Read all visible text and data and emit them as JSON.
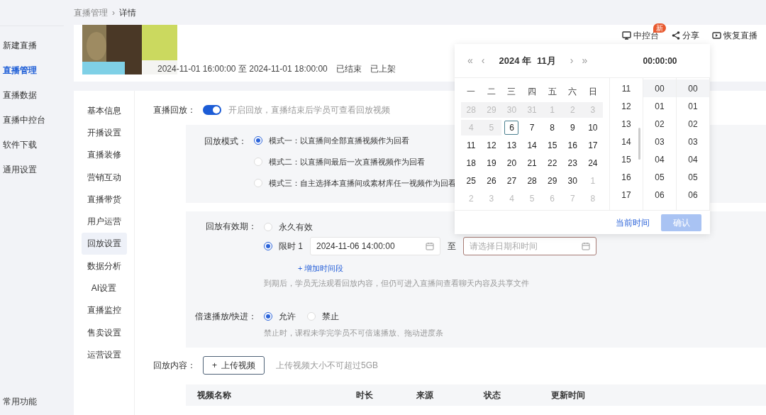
{
  "sidebar": {
    "items": [
      {
        "label": "新建直播",
        "selected": false
      },
      {
        "label": "直播管理",
        "selected": true
      },
      {
        "label": "直播数据",
        "selected": false
      },
      {
        "label": "直播中控台",
        "selected": false
      },
      {
        "label": "软件下载",
        "selected": false
      },
      {
        "label": "通用设置",
        "selected": false
      }
    ],
    "footer": "常用功能"
  },
  "breadcrumb": [
    "直播管理",
    "详情"
  ],
  "breadcrumb_separator": "›",
  "header": {
    "time": "2024-11-01 16:00:00 至 2024-11-01 18:00:00",
    "status": "已结束",
    "shelf": "已上架",
    "actions": [
      {
        "label": "中控台",
        "badge": "新"
      },
      {
        "label": "分享"
      },
      {
        "label": "恢复直播"
      }
    ]
  },
  "settings_nav": [
    {
      "label": "基本信息",
      "selected": false
    },
    {
      "label": "开播设置",
      "selected": false
    },
    {
      "label": "直播装修",
      "selected": false
    },
    {
      "label": "营销互动",
      "selected": false
    },
    {
      "label": "直播带货",
      "selected": false
    },
    {
      "label": "用户运营",
      "selected": false
    },
    {
      "label": "回放设置",
      "selected": true
    },
    {
      "label": "数据分析",
      "selected": false
    },
    {
      "label": "AI设置",
      "selected": false
    },
    {
      "label": "直播监控",
      "selected": false
    },
    {
      "label": "售卖设置",
      "selected": false
    },
    {
      "label": "运营设置",
      "selected": false
    }
  ],
  "replay": {
    "label": "直播回放：",
    "on": true,
    "hint": "开启回放，直播结束后学员可查看回放视频"
  },
  "mode": {
    "label": "回放模式：",
    "options": [
      {
        "label": "模式一：以直播间全部直播视频作为回看",
        "selected": true
      },
      {
        "label": "模式二：以直播间最后一次直播视频作为回看",
        "selected": false
      },
      {
        "label": "模式三：自主选择本直播间或素材库任一视频作为回看",
        "selected": false
      }
    ]
  },
  "validity": {
    "label": "回放有效期：",
    "options": [
      {
        "label": "永久有效",
        "selected": false
      },
      {
        "label": "限时 1",
        "selected": true
      }
    ],
    "start": "2024-11-06 14:00:00",
    "to": "至",
    "end_placeholder": "请选择日期和时间",
    "add": "+ 增加时间段",
    "hint": "到期后，学员无法观看回放内容，但仍可进入直播间查看聊天内容及共享文件"
  },
  "speed": {
    "label": "倍速播放/快进：",
    "options": [
      {
        "label": "允许",
        "selected": true
      },
      {
        "label": "禁止",
        "selected": false
      }
    ],
    "hint": "禁止时，课程未学完学员不可倍速播放、拖动进度条"
  },
  "content": {
    "label": "回放内容：",
    "upload": "上传视频",
    "upload_icon": "+",
    "hint": "上传视频大小不可超过5GB",
    "columns": [
      "视频名称",
      "时长",
      "来源",
      "状态",
      "更新时间"
    ]
  },
  "picker": {
    "nav": [
      "«",
      "‹",
      "›",
      "»"
    ],
    "year": "2024 年",
    "month": "11月",
    "time": "00:00:00",
    "weekdays": [
      "一",
      "二",
      "三",
      "四",
      "五",
      "六",
      "日"
    ],
    "days": [
      {
        "d": "28",
        "kind": "disabled"
      },
      {
        "d": "29",
        "kind": "disabled"
      },
      {
        "d": "30",
        "kind": "disabled"
      },
      {
        "d": "31",
        "kind": "disabled"
      },
      {
        "d": "1",
        "kind": "disabled"
      },
      {
        "d": "2",
        "kind": "disabled"
      },
      {
        "d": "3",
        "kind": "disabled"
      },
      {
        "d": "4",
        "kind": "disabled"
      },
      {
        "d": "5",
        "kind": "disabled"
      },
      {
        "d": "6",
        "kind": "today"
      },
      {
        "d": "7",
        "kind": "normal"
      },
      {
        "d": "8",
        "kind": "normal"
      },
      {
        "d": "9",
        "kind": "normal"
      },
      {
        "d": "10",
        "kind": "normal"
      },
      {
        "d": "11",
        "kind": "normal"
      },
      {
        "d": "12",
        "kind": "normal"
      },
      {
        "d": "13",
        "kind": "normal"
      },
      {
        "d": "14",
        "kind": "normal"
      },
      {
        "d": "15",
        "kind": "normal"
      },
      {
        "d": "16",
        "kind": "normal"
      },
      {
        "d": "17",
        "kind": "normal"
      },
      {
        "d": "18",
        "kind": "normal"
      },
      {
        "d": "19",
        "kind": "normal"
      },
      {
        "d": "20",
        "kind": "normal"
      },
      {
        "d": "21",
        "kind": "normal"
      },
      {
        "d": "22",
        "kind": "normal"
      },
      {
        "d": "23",
        "kind": "normal"
      },
      {
        "d": "24",
        "kind": "normal"
      },
      {
        "d": "25",
        "kind": "normal"
      },
      {
        "d": "26",
        "kind": "normal"
      },
      {
        "d": "27",
        "kind": "normal"
      },
      {
        "d": "28",
        "kind": "normal"
      },
      {
        "d": "29",
        "kind": "normal"
      },
      {
        "d": "30",
        "kind": "normal"
      },
      {
        "d": "1",
        "kind": "other"
      },
      {
        "d": "2",
        "kind": "other"
      },
      {
        "d": "3",
        "kind": "other"
      },
      {
        "d": "4",
        "kind": "other"
      },
      {
        "d": "5",
        "kind": "other"
      },
      {
        "d": "6",
        "kind": "other"
      },
      {
        "d": "7",
        "kind": "other"
      },
      {
        "d": "8",
        "kind": "other"
      }
    ],
    "hours": [
      {
        "v": "11",
        "selected": false
      },
      {
        "v": "12",
        "selected": false
      },
      {
        "v": "13",
        "selected": false
      },
      {
        "v": "14",
        "selected": false
      },
      {
        "v": "15",
        "selected": false
      },
      {
        "v": "16",
        "selected": false
      },
      {
        "v": "17",
        "selected": false
      }
    ],
    "minutes": [
      {
        "v": "00",
        "selected": true
      },
      {
        "v": "01",
        "selected": false
      },
      {
        "v": "02",
        "selected": false
      },
      {
        "v": "03",
        "selected": false
      },
      {
        "v": "04",
        "selected": false
      },
      {
        "v": "05",
        "selected": false
      },
      {
        "v": "06",
        "selected": false
      }
    ],
    "seconds": [
      {
        "v": "00",
        "selected": true
      },
      {
        "v": "01",
        "selected": false
      },
      {
        "v": "02",
        "selected": false
      },
      {
        "v": "03",
        "selected": false
      },
      {
        "v": "04",
        "selected": false
      },
      {
        "v": "05",
        "selected": false
      },
      {
        "v": "06",
        "selected": false
      }
    ],
    "now": "当前时间",
    "confirm": "确认",
    "confirm_disabled": true
  }
}
